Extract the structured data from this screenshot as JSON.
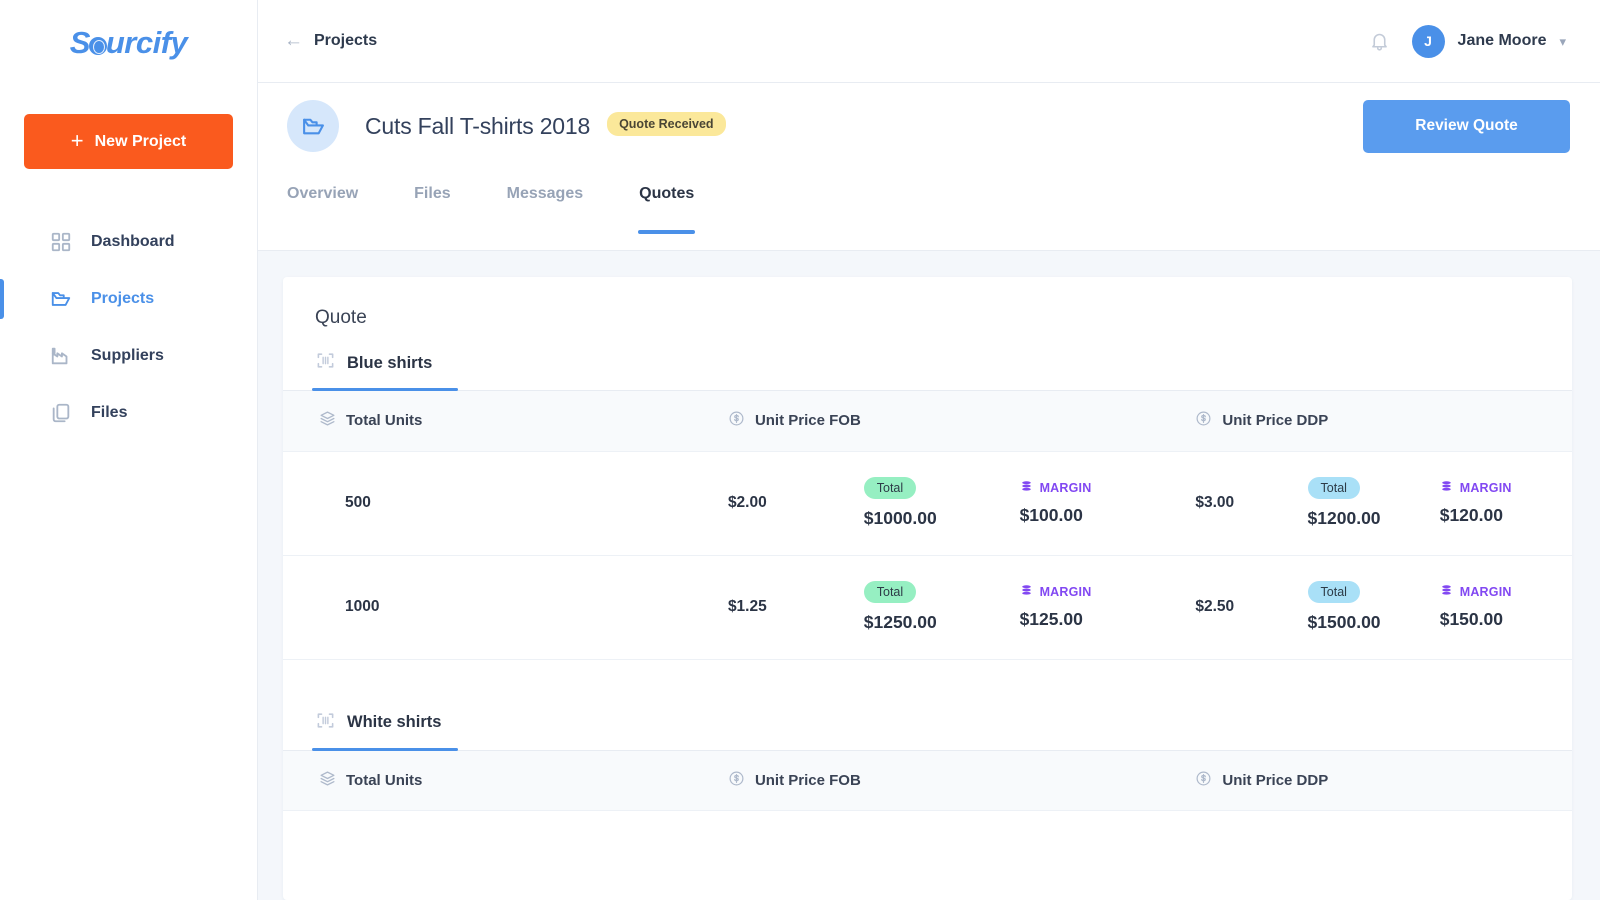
{
  "brand": {
    "name": "Sourcify",
    "accent": "#4a90e8",
    "cta_color": "#fa5a1e"
  },
  "sidebar": {
    "new_project_label": "New Project",
    "items": [
      {
        "label": "Dashboard",
        "icon": "grid-icon",
        "active": false
      },
      {
        "label": "Projects",
        "icon": "folder-open-icon",
        "active": true
      },
      {
        "label": "Suppliers",
        "icon": "factory-icon",
        "active": false
      },
      {
        "label": "Files",
        "icon": "files-icon",
        "active": false
      }
    ]
  },
  "topbar": {
    "back_label": "Projects",
    "back_icon": "arrow-left-icon",
    "bell_icon": "bell-icon",
    "user": {
      "name": "Jane Moore",
      "initial": "J",
      "caret": "chevron-down-icon"
    }
  },
  "project": {
    "icon": "folder-open-icon",
    "title": "Cuts Fall T-shirts 2018",
    "status_badge": "Quote Received",
    "status_badge_color": "#fbe89a",
    "primary_action": "Review Quote",
    "primary_action_color": "#5a9cee"
  },
  "tabs": [
    {
      "label": "Overview",
      "active": false
    },
    {
      "label": "Files",
      "active": false
    },
    {
      "label": "Messages",
      "active": false
    },
    {
      "label": "Quotes",
      "active": true
    }
  ],
  "quote_card": {
    "title": "Quote",
    "columns": {
      "units": {
        "label": "Total Units",
        "icon": "layers-icon"
      },
      "fob": {
        "label": "Unit Price FOB",
        "icon": "dollar-circle-icon"
      },
      "ddp": {
        "label": "Unit Price DDP",
        "icon": "dollar-circle-icon"
      }
    },
    "badge_labels": {
      "total": "Total",
      "margin": "MARGIN"
    },
    "margin_icon": "stack-icon",
    "margin_color": "#8248f2",
    "groups": [
      {
        "name": "Blue shirts",
        "icon": "scan-frame-icon",
        "active": true,
        "rows": [
          {
            "units": "500",
            "fob_unit": "$2.00",
            "fob_total": "$1000.00",
            "fob_margin": "$100.00",
            "ddp_unit": "$3.00",
            "ddp_total": "$1200.00",
            "ddp_margin": "$120.00"
          },
          {
            "units": "1000",
            "fob_unit": "$1.25",
            "fob_total": "$1250.00",
            "fob_margin": "$125.00",
            "ddp_unit": "$2.50",
            "ddp_total": "$1500.00",
            "ddp_margin": "$150.00"
          }
        ]
      },
      {
        "name": "White shirts",
        "icon": "scan-frame-icon",
        "active": true,
        "rows": []
      }
    ]
  }
}
